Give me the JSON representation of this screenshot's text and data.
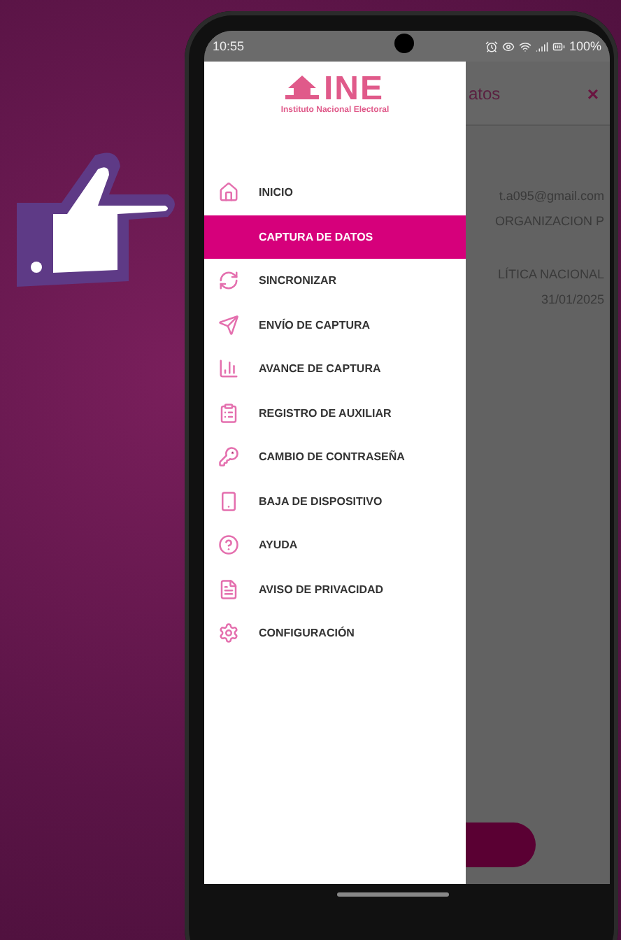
{
  "status_bar": {
    "time": "10:55",
    "battery": "100%"
  },
  "drawer": {
    "logo": {
      "name": "INE",
      "subtitle": "Instituto Nacional Electoral"
    },
    "items": [
      {
        "label": "INICIO",
        "selected": false
      },
      {
        "label": "CAPTURA DE DATOS",
        "selected": true
      },
      {
        "label": "SINCRONIZAR",
        "selected": false
      },
      {
        "label": "ENVÍO DE CAPTURA",
        "selected": false
      },
      {
        "label": "AVANCE DE CAPTURA",
        "selected": false
      },
      {
        "label": "REGISTRO DE AUXILIAR",
        "selected": false
      },
      {
        "label": "CAMBIO DE CONTRASEÑA",
        "selected": false
      },
      {
        "label": "BAJA DE DISPOSITIVO",
        "selected": false
      },
      {
        "label": "AYUDA",
        "selected": false
      },
      {
        "label": "AVISO DE PRIVACIDAD",
        "selected": false
      },
      {
        "label": "CONFIGURACIÓN",
        "selected": false
      }
    ]
  },
  "background_screen": {
    "title": "atos",
    "close": "×",
    "lines": [
      "t.a095@gmail.com",
      "ORGANIZACION P",
      "LÍTICA NACIONAL",
      "31/01/2025"
    ]
  }
}
